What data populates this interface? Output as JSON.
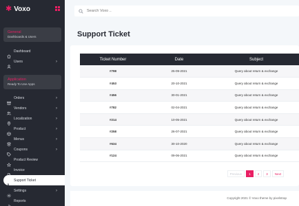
{
  "app": {
    "name": "Voxo"
  },
  "sidebar": {
    "section1": {
      "title": "General",
      "subtitle": "Dashboards & Users"
    },
    "section2": {
      "title": "Application",
      "subtitle": "Ready To Use Apps"
    },
    "general_items": [
      {
        "label": "Dashboard",
        "icon": "home-icon",
        "chevron": false
      },
      {
        "label": "Users",
        "icon": "user-icon",
        "chevron": true
      }
    ],
    "app_items": [
      {
        "label": "Orders",
        "icon": "archive-icon",
        "chevron": true
      },
      {
        "label": "Vendors",
        "icon": "users-icon",
        "chevron": true
      },
      {
        "label": "Localization",
        "icon": "map-pin-icon",
        "chevron": true
      },
      {
        "label": "Product",
        "icon": "box-icon",
        "chevron": true
      },
      {
        "label": "Menus",
        "icon": "menu-icon",
        "chevron": true
      },
      {
        "label": "Coupons",
        "icon": "tag-icon",
        "chevron": true
      },
      {
        "label": "Product Review",
        "icon": "star-icon",
        "chevron": false
      },
      {
        "label": "Invoice",
        "icon": "file-icon",
        "chevron": false
      },
      {
        "label": "Support Ticket",
        "icon": "phone-icon",
        "chevron": false,
        "active": true
      },
      {
        "label": "Settings",
        "icon": "settings-icon",
        "chevron": true
      },
      {
        "label": "Reports",
        "icon": "bar-chart-icon",
        "chevron": false
      }
    ]
  },
  "header": {
    "search_placeholder": "Search Voxo .."
  },
  "page": {
    "title": "Support Ticket"
  },
  "table": {
    "columns": [
      "Ticket Number",
      "Date",
      "Subject"
    ],
    "rows": [
      [
        "#798",
        "25-09-2021",
        "Query about return & exchange"
      ],
      [
        "#453",
        "20-10-2021",
        "Query about return & exchange"
      ],
      [
        "#456",
        "30-01-2021",
        "Query about return & exchange"
      ],
      [
        "#782",
        "02-04-2021",
        "Query about return & exchange"
      ],
      [
        "#214",
        "10-05-2021",
        "Query about return & exchange"
      ],
      [
        "#258",
        "26-07-2021",
        "Query about return & exchange"
      ],
      [
        "#634",
        "30-10-2020",
        "Query about return & exchange"
      ],
      [
        "#124",
        "09-06-2021",
        "Query about return & exchange"
      ]
    ]
  },
  "pagination": {
    "previous": "Previous",
    "pages": [
      "1",
      "2",
      "3"
    ],
    "current": "1",
    "next": "Next"
  },
  "footer": {
    "text": "Copyright 2021 © Voxo theme by pixelstrap"
  },
  "colors": {
    "accent": "#e91e63",
    "sidebar_bg": "#262932",
    "page_bg": "#f4f7fa"
  }
}
